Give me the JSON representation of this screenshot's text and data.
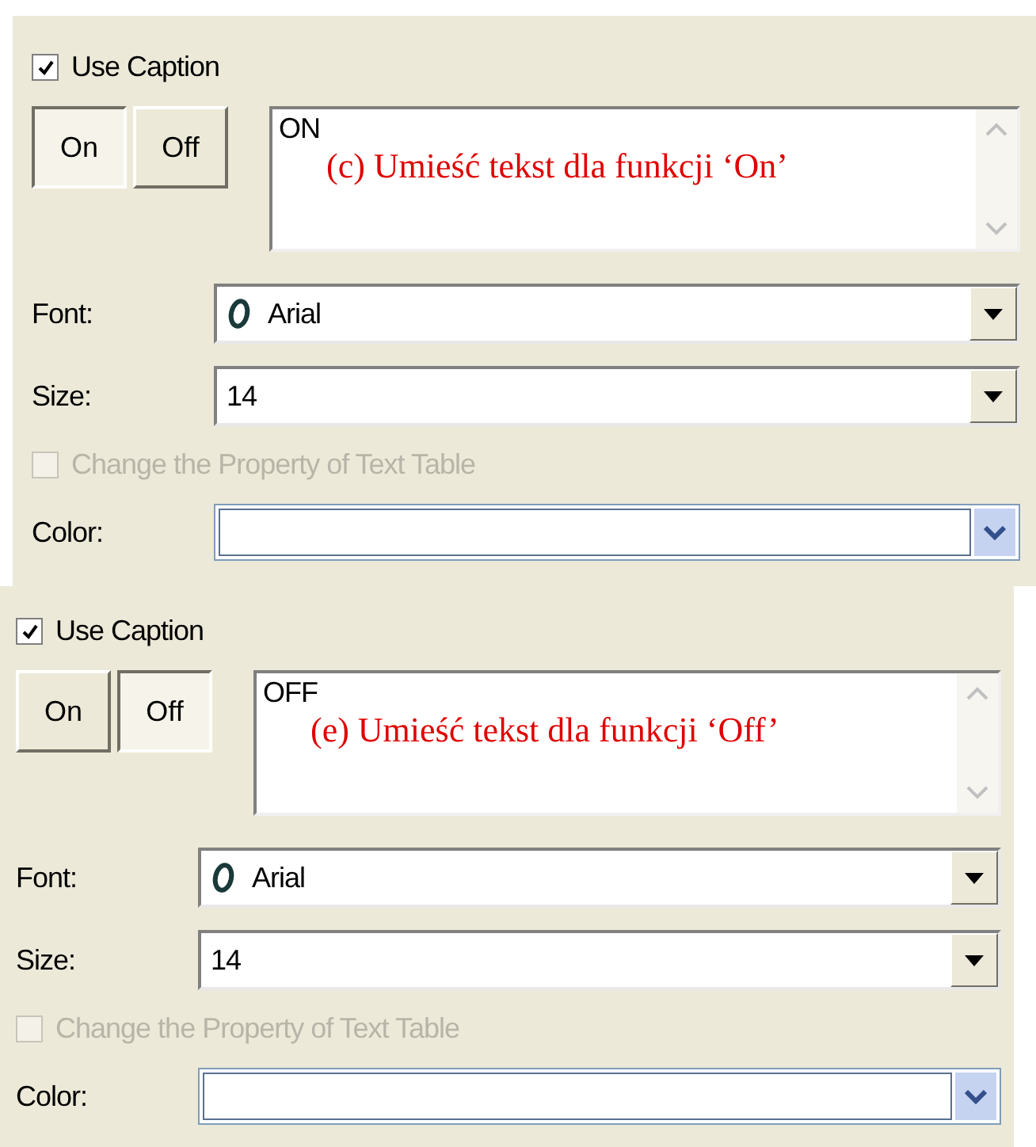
{
  "panels": [
    {
      "use_caption": {
        "label": "Use Caption",
        "checked": true
      },
      "toggle_buttons": [
        {
          "label": "On",
          "selected": true
        },
        {
          "label": "Off",
          "selected": false
        }
      ],
      "caption_text": "ON",
      "annotation": "(c) Umieść tekst dla funkcji ‘On’",
      "font": {
        "label": "Font:",
        "value": "Arial"
      },
      "size": {
        "label": "Size:",
        "value": "14"
      },
      "change_property": {
        "label": "Change the Property of Text Table",
        "checked": false,
        "disabled": true
      },
      "color": {
        "label": "Color:"
      }
    },
    {
      "use_caption": {
        "label": "Use Caption",
        "checked": true
      },
      "toggle_buttons": [
        {
          "label": "On",
          "selected": false
        },
        {
          "label": "Off",
          "selected": true
        }
      ],
      "caption_text": "OFF",
      "annotation": "(e) Umieść tekst dla funkcji ‘Off’",
      "font": {
        "label": "Font:",
        "value": "Arial"
      },
      "size": {
        "label": "Size:",
        "value": "14"
      },
      "change_property": {
        "label": "Change the Property of Text Table",
        "checked": false,
        "disabled": true
      },
      "color": {
        "label": "Color:"
      }
    }
  ]
}
